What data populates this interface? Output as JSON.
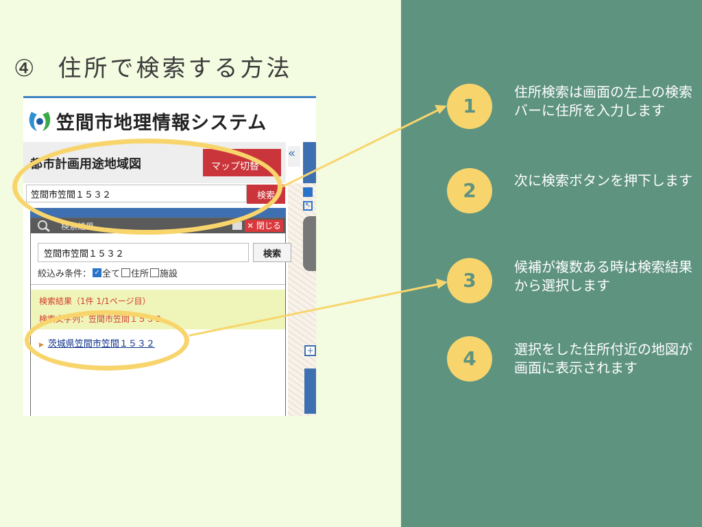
{
  "title": {
    "number": "④",
    "text": "住所で検索する方法"
  },
  "app": {
    "title": "笠間市地理情報システム",
    "map_name": "都市計画用途地域図",
    "map_switch_label": "マップ切替",
    "collapse_label": "«",
    "search_value": "笠間市笠間１５３２",
    "search_button": "検索"
  },
  "dialog": {
    "title": "検索結果",
    "close_label": "✕ 閉じる",
    "input_value": "笠間市笠間１５３２",
    "search_button": "検索",
    "filter_label": "絞込み条件：",
    "filter_all": "全て",
    "filter_address": "住所",
    "filter_facility": "施設",
    "result_header": "検索結果（1件 1/1ページ目）",
    "result_query": "検索文字列：笠間市笠間１５３２",
    "result_item": "茨城県笠間市笠間１５３２"
  },
  "steps": [
    {
      "number": "1",
      "text": "住所検索は画面の左上の検索バーに住所を入力します"
    },
    {
      "number": "2",
      "text": "次に検索ボタンを押下します"
    },
    {
      "number": "3",
      "text": "候補が複数ある時は検索結果から選択します"
    },
    {
      "number": "4",
      "text": "選択をした住所付近の地図が画面に表示されます"
    }
  ],
  "colors": {
    "background": "#f3fbe1",
    "panel": "#5e9380",
    "accent": "#f8d56c",
    "app_red": "#c9353a",
    "app_blue": "#3e6fb0"
  }
}
